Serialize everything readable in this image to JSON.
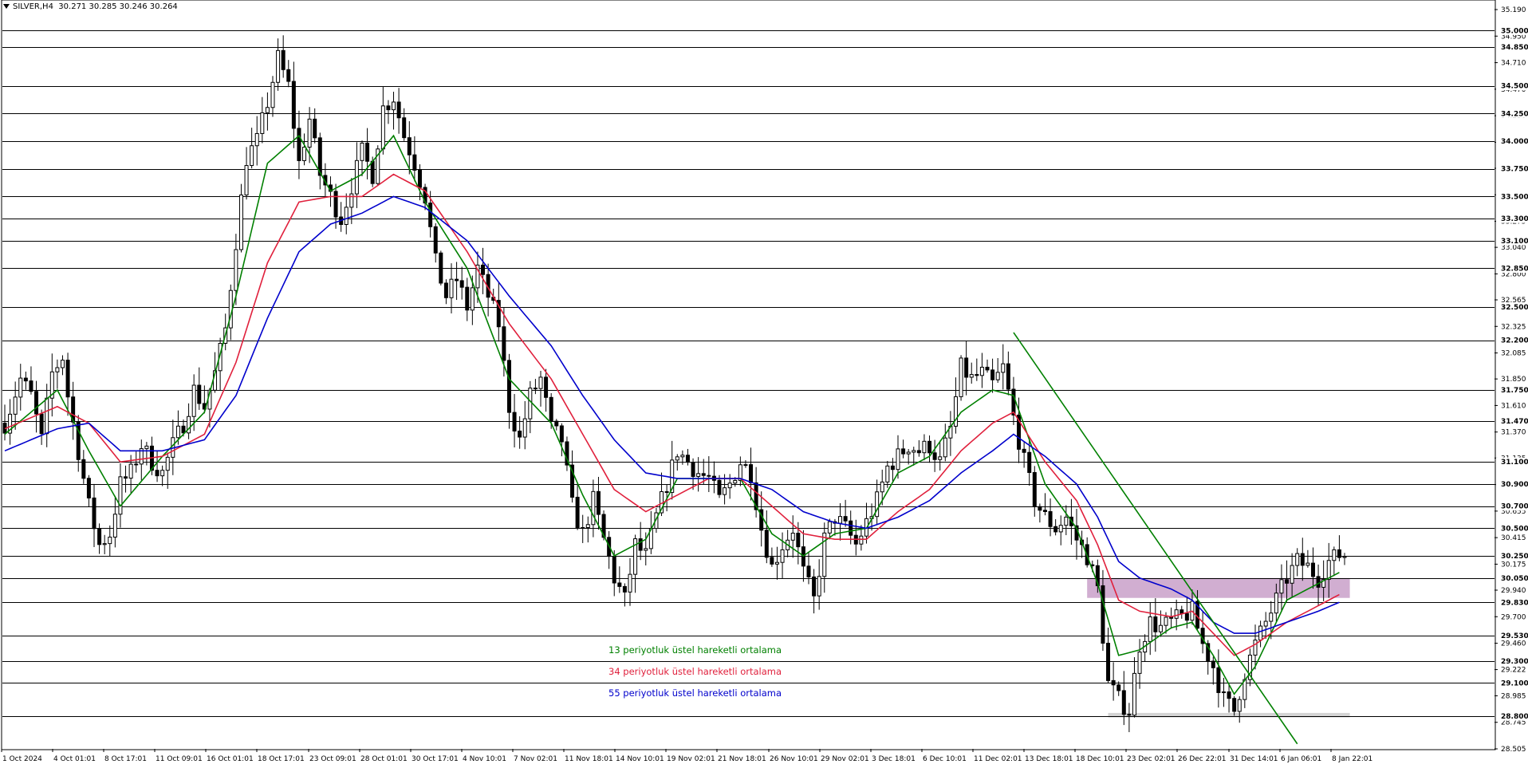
{
  "header": {
    "symbol": "SILVER,H4",
    "ohlc": "30.271 30.285 30.246 30.264"
  },
  "legend": [
    {
      "label": "13 periyotluk üstel hareketli ortalama",
      "color": "#008000"
    },
    {
      "label": "34 periyotluk üstel hareketli ortalama",
      "color": "#e0203c"
    },
    {
      "label": "55 periyotluk üstel hareketli ortalama",
      "color": "#0000cc"
    }
  ],
  "chart_data": {
    "type": "candlestick",
    "symbol": "SILVER",
    "timeframe": "H4",
    "ylim": [
      28.505,
      35.19
    ],
    "y_ticks": [
      "35.190",
      "34.950",
      "34.710",
      "34.470",
      "34.230",
      "33.990",
      "33.755",
      "33.515",
      "33.275",
      "33.040",
      "32.800",
      "32.565",
      "32.325",
      "32.085",
      "31.850",
      "31.610",
      "31.370",
      "31.135",
      "30.895",
      "30.655",
      "30.415",
      "30.175",
      "29.940",
      "29.700",
      "29.460",
      "29.222",
      "28.985",
      "28.745",
      "28.505"
    ],
    "horizontal_levels": [
      "35.000",
      "34.850",
      "34.500",
      "34.250",
      "34.000",
      "33.750",
      "33.500",
      "33.300",
      "33.100",
      "32.850",
      "32.500",
      "32.200",
      "31.750",
      "31.470",
      "31.100",
      "30.900",
      "30.700",
      "30.500",
      "30.250",
      "30.050",
      "29.830",
      "29.530",
      "29.300",
      "29.100",
      "28.800"
    ],
    "x_ticks": [
      "1 Oct 2024",
      "4 Oct 01:01",
      "8 Oct 17:01",
      "11 Oct 09:01",
      "16 Oct 01:01",
      "18 Oct 17:01",
      "23 Oct 09:01",
      "28 Oct 01:01",
      "30 Oct 17:01",
      "4 Nov 10:01",
      "7 Nov 02:01",
      "11 Nov 18:01",
      "14 Nov 10:01",
      "19 Nov 02:01",
      "21 Nov 18:01",
      "26 Nov 10:01",
      "29 Nov 02:01",
      "3 Dec 18:01",
      "6 Dec 10:01",
      "11 Dec 02:01",
      "13 Dec 18:01",
      "18 Dec 10:01",
      "23 Dec 02:01",
      "26 Dec 22:01",
      "31 Dec 14:01",
      "6 Jan 06:01",
      "8 Jan 22:01"
    ],
    "price_path": [
      [
        0,
        31.45
      ],
      [
        3,
        31.85
      ],
      [
        5,
        31.7
      ],
      [
        7,
        31.3
      ],
      [
        9,
        31.9
      ],
      [
        11,
        32.05
      ],
      [
        12,
        31.7
      ],
      [
        14,
        31.2
      ],
      [
        16,
        30.7
      ],
      [
        18,
        30.35
      ],
      [
        20,
        30.45
      ],
      [
        22,
        30.9
      ],
      [
        24,
        31.0
      ],
      [
        26,
        31.25
      ],
      [
        28,
        31.1
      ],
      [
        30,
        31.0
      ],
      [
        32,
        31.25
      ],
      [
        34,
        31.45
      ],
      [
        36,
        31.75
      ],
      [
        38,
        31.6
      ],
      [
        40,
        31.9
      ],
      [
        42,
        32.3
      ],
      [
        44,
        33.1
      ],
      [
        46,
        33.85
      ],
      [
        48,
        34.0
      ],
      [
        50,
        34.35
      ],
      [
        52,
        34.75
      ],
      [
        54,
        34.5
      ],
      [
        56,
        33.8
      ],
      [
        58,
        34.2
      ],
      [
        60,
        33.7
      ],
      [
        62,
        33.5
      ],
      [
        64,
        33.3
      ],
      [
        66,
        33.6
      ],
      [
        68,
        33.9
      ],
      [
        70,
        33.7
      ],
      [
        72,
        34.3
      ],
      [
        74,
        34.4
      ],
      [
        76,
        34.05
      ],
      [
        78,
        33.8
      ],
      [
        80,
        33.5
      ],
      [
        82,
        32.9
      ],
      [
        84,
        32.6
      ],
      [
        86,
        32.75
      ],
      [
        88,
        32.5
      ],
      [
        90,
        32.85
      ],
      [
        92,
        32.6
      ],
      [
        94,
        32.35
      ],
      [
        96,
        31.6
      ],
      [
        98,
        31.3
      ],
      [
        100,
        31.7
      ],
      [
        102,
        31.85
      ],
      [
        104,
        31.4
      ],
      [
        106,
        31.3
      ],
      [
        108,
        30.7
      ],
      [
        110,
        30.45
      ],
      [
        112,
        30.75
      ],
      [
        114,
        30.4
      ],
      [
        116,
        30.05
      ],
      [
        118,
        29.85
      ],
      [
        120,
        30.35
      ],
      [
        122,
        30.25
      ],
      [
        124,
        30.6
      ],
      [
        126,
        30.9
      ],
      [
        128,
        31.2
      ],
      [
        130,
        31.1
      ],
      [
        132,
        31.0
      ],
      [
        134,
        30.95
      ],
      [
        136,
        30.75
      ],
      [
        138,
        30.9
      ],
      [
        140,
        31.1
      ],
      [
        142,
        31.0
      ],
      [
        144,
        30.5
      ],
      [
        146,
        30.15
      ],
      [
        148,
        30.35
      ],
      [
        150,
        30.5
      ],
      [
        152,
        30.1
      ],
      [
        154,
        29.85
      ],
      [
        156,
        30.4
      ],
      [
        158,
        30.6
      ],
      [
        160,
        30.5
      ],
      [
        162,
        30.35
      ],
      [
        164,
        30.55
      ],
      [
        166,
        30.75
      ],
      [
        168,
        31.05
      ],
      [
        170,
        31.15
      ],
      [
        172,
        31.25
      ],
      [
        174,
        31.2
      ],
      [
        176,
        31.25
      ],
      [
        178,
        31.1
      ],
      [
        180,
        31.4
      ],
      [
        182,
        31.95
      ],
      [
        184,
        31.85
      ],
      [
        186,
        31.9
      ],
      [
        188,
        31.8
      ],
      [
        190,
        31.95
      ],
      [
        192,
        31.5
      ],
      [
        194,
        31.1
      ],
      [
        196,
        30.75
      ],
      [
        198,
        30.6
      ],
      [
        200,
        30.5
      ],
      [
        202,
        30.6
      ],
      [
        204,
        30.4
      ],
      [
        206,
        30.25
      ],
      [
        208,
        29.95
      ],
      [
        210,
        29.1
      ],
      [
        212,
        28.95
      ],
      [
        214,
        28.85
      ],
      [
        216,
        29.45
      ],
      [
        218,
        29.65
      ],
      [
        220,
        29.6
      ],
      [
        222,
        29.65
      ],
      [
        224,
        29.7
      ],
      [
        226,
        29.75
      ],
      [
        228,
        29.45
      ],
      [
        230,
        29.25
      ],
      [
        232,
        28.95
      ],
      [
        234,
        28.85
      ],
      [
        236,
        29.2
      ],
      [
        238,
        29.45
      ],
      [
        240,
        29.65
      ],
      [
        242,
        29.85
      ],
      [
        244,
        30.05
      ],
      [
        246,
        30.2
      ],
      [
        248,
        30.15
      ],
      [
        250,
        30.05
      ],
      [
        252,
        30.2
      ],
      [
        254,
        30.26
      ]
    ],
    "ema13": [
      [
        0,
        31.35
      ],
      [
        10,
        31.75
      ],
      [
        16,
        31.2
      ],
      [
        22,
        30.7
      ],
      [
        30,
        31.15
      ],
      [
        38,
        31.55
      ],
      [
        44,
        32.6
      ],
      [
        50,
        33.8
      ],
      [
        56,
        34.05
      ],
      [
        62,
        33.55
      ],
      [
        68,
        33.7
      ],
      [
        74,
        34.05
      ],
      [
        80,
        33.45
      ],
      [
        88,
        32.85
      ],
      [
        96,
        31.85
      ],
      [
        104,
        31.45
      ],
      [
        110,
        30.8
      ],
      [
        116,
        30.25
      ],
      [
        122,
        30.4
      ],
      [
        128,
        30.95
      ],
      [
        134,
        30.95
      ],
      [
        140,
        30.95
      ],
      [
        146,
        30.45
      ],
      [
        152,
        30.25
      ],
      [
        158,
        30.45
      ],
      [
        164,
        30.5
      ],
      [
        170,
        31.0
      ],
      [
        176,
        31.15
      ],
      [
        182,
        31.55
      ],
      [
        188,
        31.75
      ],
      [
        192,
        31.7
      ],
      [
        198,
        30.9
      ],
      [
        204,
        30.5
      ],
      [
        208,
        30.0
      ],
      [
        212,
        29.35
      ],
      [
        216,
        29.4
      ],
      [
        222,
        29.6
      ],
      [
        226,
        29.65
      ],
      [
        230,
        29.35
      ],
      [
        234,
        29.0
      ],
      [
        238,
        29.25
      ],
      [
        244,
        29.85
      ],
      [
        250,
        30.0
      ],
      [
        254,
        30.1
      ]
    ],
    "ema34": [
      [
        0,
        31.4
      ],
      [
        10,
        31.6
      ],
      [
        16,
        31.45
      ],
      [
        22,
        31.1
      ],
      [
        30,
        31.15
      ],
      [
        38,
        31.35
      ],
      [
        44,
        32.0
      ],
      [
        50,
        32.9
      ],
      [
        56,
        33.45
      ],
      [
        62,
        33.5
      ],
      [
        68,
        33.5
      ],
      [
        74,
        33.7
      ],
      [
        80,
        33.55
      ],
      [
        88,
        33.0
      ],
      [
        96,
        32.35
      ],
      [
        104,
        31.85
      ],
      [
        110,
        31.35
      ],
      [
        116,
        30.85
      ],
      [
        122,
        30.65
      ],
      [
        128,
        30.8
      ],
      [
        134,
        30.95
      ],
      [
        140,
        30.95
      ],
      [
        146,
        30.7
      ],
      [
        152,
        30.45
      ],
      [
        158,
        30.4
      ],
      [
        164,
        30.4
      ],
      [
        170,
        30.65
      ],
      [
        176,
        30.85
      ],
      [
        182,
        31.2
      ],
      [
        188,
        31.45
      ],
      [
        192,
        31.55
      ],
      [
        198,
        31.1
      ],
      [
        204,
        30.75
      ],
      [
        208,
        30.35
      ],
      [
        212,
        29.85
      ],
      [
        216,
        29.75
      ],
      [
        222,
        29.7
      ],
      [
        226,
        29.75
      ],
      [
        230,
        29.55
      ],
      [
        234,
        29.35
      ],
      [
        238,
        29.45
      ],
      [
        244,
        29.65
      ],
      [
        250,
        29.8
      ],
      [
        254,
        29.9
      ]
    ],
    "ema55": [
      [
        0,
        31.2
      ],
      [
        10,
        31.4
      ],
      [
        16,
        31.45
      ],
      [
        22,
        31.2
      ],
      [
        30,
        31.2
      ],
      [
        38,
        31.3
      ],
      [
        44,
        31.7
      ],
      [
        50,
        32.4
      ],
      [
        56,
        33.0
      ],
      [
        62,
        33.25
      ],
      [
        68,
        33.35
      ],
      [
        74,
        33.5
      ],
      [
        80,
        33.4
      ],
      [
        88,
        33.1
      ],
      [
        96,
        32.6
      ],
      [
        104,
        32.15
      ],
      [
        110,
        31.7
      ],
      [
        116,
        31.3
      ],
      [
        122,
        31.0
      ],
      [
        128,
        30.95
      ],
      [
        134,
        30.95
      ],
      [
        140,
        30.95
      ],
      [
        146,
        30.85
      ],
      [
        152,
        30.65
      ],
      [
        158,
        30.55
      ],
      [
        164,
        30.5
      ],
      [
        170,
        30.6
      ],
      [
        176,
        30.75
      ],
      [
        182,
        31.0
      ],
      [
        188,
        31.2
      ],
      [
        192,
        31.35
      ],
      [
        198,
        31.15
      ],
      [
        204,
        30.9
      ],
      [
        208,
        30.6
      ],
      [
        212,
        30.2
      ],
      [
        216,
        30.05
      ],
      [
        222,
        29.95
      ],
      [
        226,
        29.85
      ],
      [
        230,
        29.65
      ],
      [
        234,
        29.55
      ],
      [
        238,
        29.55
      ],
      [
        244,
        29.65
      ],
      [
        250,
        29.75
      ],
      [
        254,
        29.83
      ]
    ],
    "trendline": {
      "from": [
        192,
        32.27
      ],
      "to": [
        246,
        28.55
      ],
      "color": "#008000"
    },
    "zones": [
      {
        "x": [
          206,
          256
        ],
        "y": [
          29.87,
          30.05
        ],
        "color": "#c9a0c9"
      },
      {
        "x": [
          210,
          256
        ],
        "y": [
          28.79,
          28.83
        ],
        "color": "#cccccc"
      }
    ]
  }
}
